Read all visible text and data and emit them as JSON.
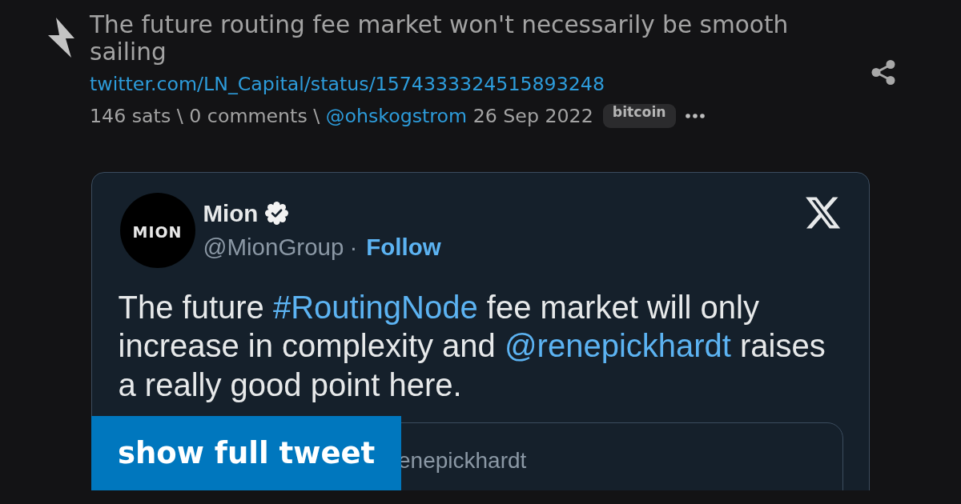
{
  "post": {
    "title": "The future routing fee market won't necessarily be smooth sailing",
    "url": "twitter.com/LN_Capital/status/1574333324515893248",
    "stats": "146 sats \\ 0 comments \\",
    "author": "@ohskogstrom",
    "date": "26 Sep 2022",
    "tags": [
      "bitcoin"
    ]
  },
  "tweet": {
    "avatar_label": "MION",
    "name": "Mion",
    "verified": true,
    "handle": "@MionGroup",
    "separator": "·",
    "follow": "Follow",
    "body": [
      {
        "kind": "plain",
        "text": "The future "
      },
      {
        "kind": "hashtag",
        "text": "#RoutingNode"
      },
      {
        "kind": "plain",
        "text": " fee market will only increase in complexity and "
      },
      {
        "kind": "mention",
        "text": "@renepickhardt"
      },
      {
        "kind": "plain",
        "text": " raises a really good point here."
      }
    ],
    "quoted": {
      "author": "enepickhardt"
    },
    "expand_button": "show full tweet"
  }
}
